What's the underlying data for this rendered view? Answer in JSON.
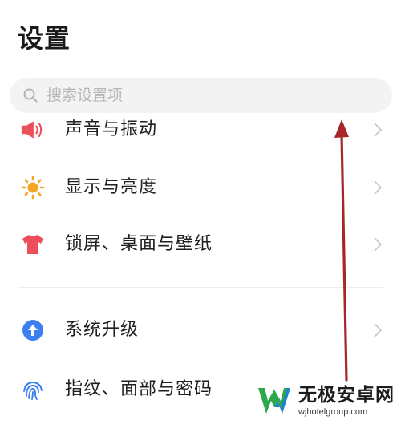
{
  "header": {
    "title": "设置"
  },
  "search": {
    "placeholder": "搜索设置项"
  },
  "settings_items": [
    {
      "label": "声音与振动",
      "icon": "speaker-icon",
      "color": "#ee4d5a"
    },
    {
      "label": "显示与亮度",
      "icon": "sun-icon",
      "color": "#f6a623"
    },
    {
      "label": "锁屏、桌面与壁纸",
      "icon": "tshirt-icon",
      "color": "#ee4d5a"
    },
    {
      "label": "系统升级",
      "icon": "upgrade-arrow-icon",
      "color": "#3b7ff0"
    },
    {
      "label": "指纹、面部与密码",
      "icon": "fingerprint-icon",
      "color": "#3b7ff0"
    }
  ],
  "annotation": {
    "arrow_color": "#a8282a",
    "direction": "up"
  },
  "watermark": {
    "title": "无极安卓网",
    "url": "wjhotelgroup.com",
    "colors": [
      "#2aa84a",
      "#1d7fd6"
    ]
  }
}
